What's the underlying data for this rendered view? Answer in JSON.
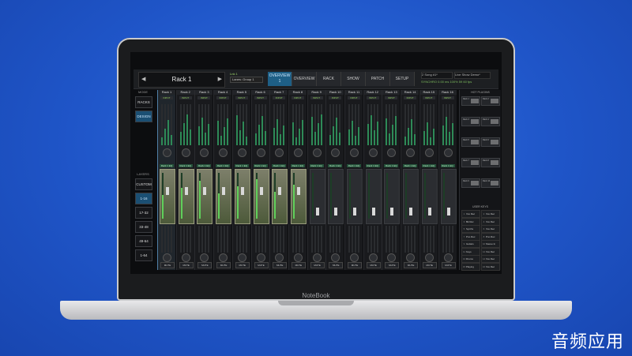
{
  "app": {
    "rack_name": "Rack 1",
    "layer_line1": "Lnk 1",
    "layer_line2": "Lanes: Group 1",
    "tabs": [
      "OVERVIEW 1",
      "OVERVIEW 2",
      "RACK",
      "SHOW",
      "PATCH",
      "SETUP"
    ],
    "song_name": "2 Song #1*",
    "show_name": "Live Show Demo*",
    "status_line": "SYNCHRO 0.00 ms 100% 59 60 fps",
    "left_panel": {
      "mode_label": "MODE",
      "racks": "RACKS",
      "design": "DESIGN",
      "layers_label": "LAYERS",
      "custom": "CUSTOM",
      "ranges": [
        "1-16",
        "17-32",
        "33-48",
        "49-64",
        "1-64"
      ]
    },
    "strips": [
      "Rack 1",
      "Rack 2",
      "Rack 3",
      "Rack 4",
      "Rack 5",
      "Rack 6",
      "Rack 7",
      "Rack 8",
      "Rack 9",
      "Rack 10",
      "Rack 11",
      "Rack 12",
      "Rack 13",
      "Rack 14",
      "Rack 15",
      "Rack 16"
    ],
    "input_label": "INPUT",
    "plugin_label": "Rack 1 EQ",
    "mute_label": "MUTE",
    "right_panel": {
      "title": "HOT PLUGINS",
      "user_keys_label": "USER KEYS",
      "plugins": [
        "Rack 1",
        "Rack 2",
        "Rack 3",
        "Rack 4",
        "Rack 5",
        "Rack 6",
        "Rack 7",
        "Rack 8",
        "Rack 9",
        "Rack 10"
      ],
      "user_keys": [
        [
          "Vox Rec",
          "Vox Rec"
        ],
        [
          "Bk Rec",
          "Vox Rec"
        ],
        [
          "Synths",
          "Vox Rec"
        ],
        [
          "Pno Rec",
          "Pno Rec"
        ],
        [
          "Guitars",
          "Stereo In"
        ],
        [
          "Keys",
          "Vox Rec"
        ],
        [
          "Drums",
          "Vox Rec"
        ],
        [
          "Playing",
          "Vox Rec"
        ]
      ]
    },
    "brand": "NoteBook",
    "watermark": "音频应用"
  }
}
